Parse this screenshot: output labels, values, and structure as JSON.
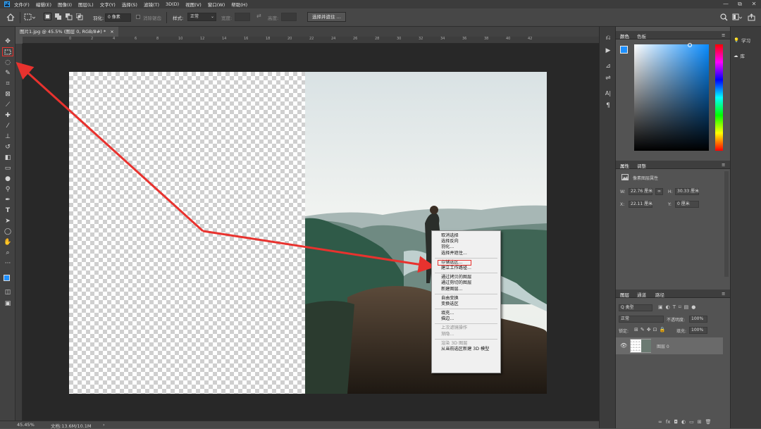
{
  "menubar": {
    "app_icon": "Ps",
    "items": [
      "文件(F)",
      "编辑(E)",
      "图像(I)",
      "图层(L)",
      "文字(Y)",
      "选择(S)",
      "滤镜(T)",
      "3D(D)",
      "视图(V)",
      "窗口(W)",
      "帮助(H)"
    ],
    "window_controls": [
      "—",
      "⧉",
      "✕"
    ]
  },
  "options": {
    "feather_label": "羽化:",
    "feather_value": "0 像素",
    "antialias_label": "消除锯齿",
    "style_label": "样式:",
    "style_value": "正常",
    "width_label": "宽度:",
    "height_label": "高度:",
    "select_mask_button": "选择并遮住 ..."
  },
  "document": {
    "tab_title": "图片1.jpg @ 45.5% (图层 0, RGB/8#) *",
    "tab_close": "×",
    "ruler_ticks": [
      "0",
      "2",
      "4",
      "6",
      "8",
      "10",
      "12",
      "14",
      "16",
      "18",
      "20",
      "22",
      "24",
      "26",
      "28",
      "30",
      "32",
      "34",
      "36",
      "38",
      "40",
      "42"
    ]
  },
  "context_menu": {
    "groups": [
      [
        {
          "label": "取消选择",
          "enabled": true
        },
        {
          "label": "选择反向",
          "enabled": true
        },
        {
          "label": "羽化...",
          "enabled": true
        },
        {
          "label": "选择并遮住...",
          "enabled": true
        }
      ],
      [
        {
          "label": "存储选区...",
          "enabled": true
        },
        {
          "label": "建立工作路径...",
          "enabled": true
        }
      ],
      [
        {
          "label": "通过拷贝的图层",
          "enabled": true
        },
        {
          "label": "通过剪切的图层",
          "enabled": true
        },
        {
          "label": "新建图层...",
          "enabled": true
        }
      ],
      [
        {
          "label": "自由变换",
          "enabled": true
        },
        {
          "label": "变换选区",
          "enabled": true
        }
      ],
      [
        {
          "label": "填充...",
          "enabled": true
        },
        {
          "label": "描边...",
          "enabled": true
        }
      ],
      [
        {
          "label": "上次滤镜操作",
          "enabled": false
        },
        {
          "label": "渐隐...",
          "enabled": false
        }
      ],
      [
        {
          "label": "渲染 3D 图层",
          "enabled": false
        },
        {
          "label": "从当前选区新建 3D 模型",
          "enabled": true
        }
      ]
    ],
    "highlighted_item": "存储选区..."
  },
  "status": {
    "zoom": "45.45%",
    "doc_info": "文档:13.6M/10.1M",
    "arrow": "›"
  },
  "color_panel": {
    "tabs": [
      "颜色",
      "色板"
    ],
    "fg_color": "#1e90ff",
    "bg_color": "#ffffff"
  },
  "properties_panel": {
    "tabs": [
      "属性",
      "调整"
    ],
    "layer_type": "像素图层属性",
    "w_label": "W:",
    "w_value": "22.76 厘米",
    "link": "∞",
    "h_label": "H:",
    "h_value": "30.33 厘米",
    "x_label": "X:",
    "x_value": "22.11 厘米",
    "y_label": "Y:",
    "y_value": "0 厘米"
  },
  "layers_panel": {
    "tabs": [
      "图层",
      "通道",
      "路径"
    ],
    "filter_label": "Q 类型",
    "blend_mode": "正常",
    "opacity_label": "不透明度:",
    "opacity_value": "100%",
    "lock_label": "锁定:",
    "fill_label": "填充:",
    "fill_value": "100%",
    "layer_name": "图层 0",
    "bottom_icons": [
      "∞",
      "fx",
      "◘",
      "◐",
      "▭",
      "⊞",
      "🗑"
    ]
  },
  "right_strip": {
    "learn": "学习",
    "libraries": "库"
  },
  "colors": {
    "accent_red": "#e8322e",
    "highlight_box": "#e8322e"
  }
}
